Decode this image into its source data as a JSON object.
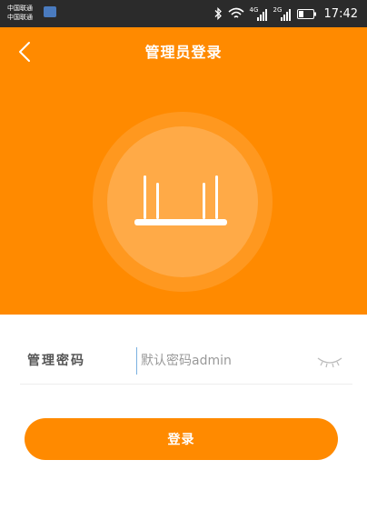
{
  "status_bar": {
    "carrier_top": "中国联通",
    "carrier_bottom": "中国联通",
    "network_a": "4G",
    "network_b": "2G",
    "time": "17:42"
  },
  "header": {
    "title": "管理员登录",
    "back_icon": "chevron-left-icon",
    "illustration_icon": "router-icon"
  },
  "form": {
    "password_label": "管理密码",
    "password_placeholder": "默认密码admin",
    "password_value": "",
    "visibility_icon": "eye-closed-icon"
  },
  "actions": {
    "login_label": "登录"
  },
  "colors": {
    "accent": "#ff8a00",
    "status_bar": "#2b2b2b",
    "background": "#ffffff"
  }
}
